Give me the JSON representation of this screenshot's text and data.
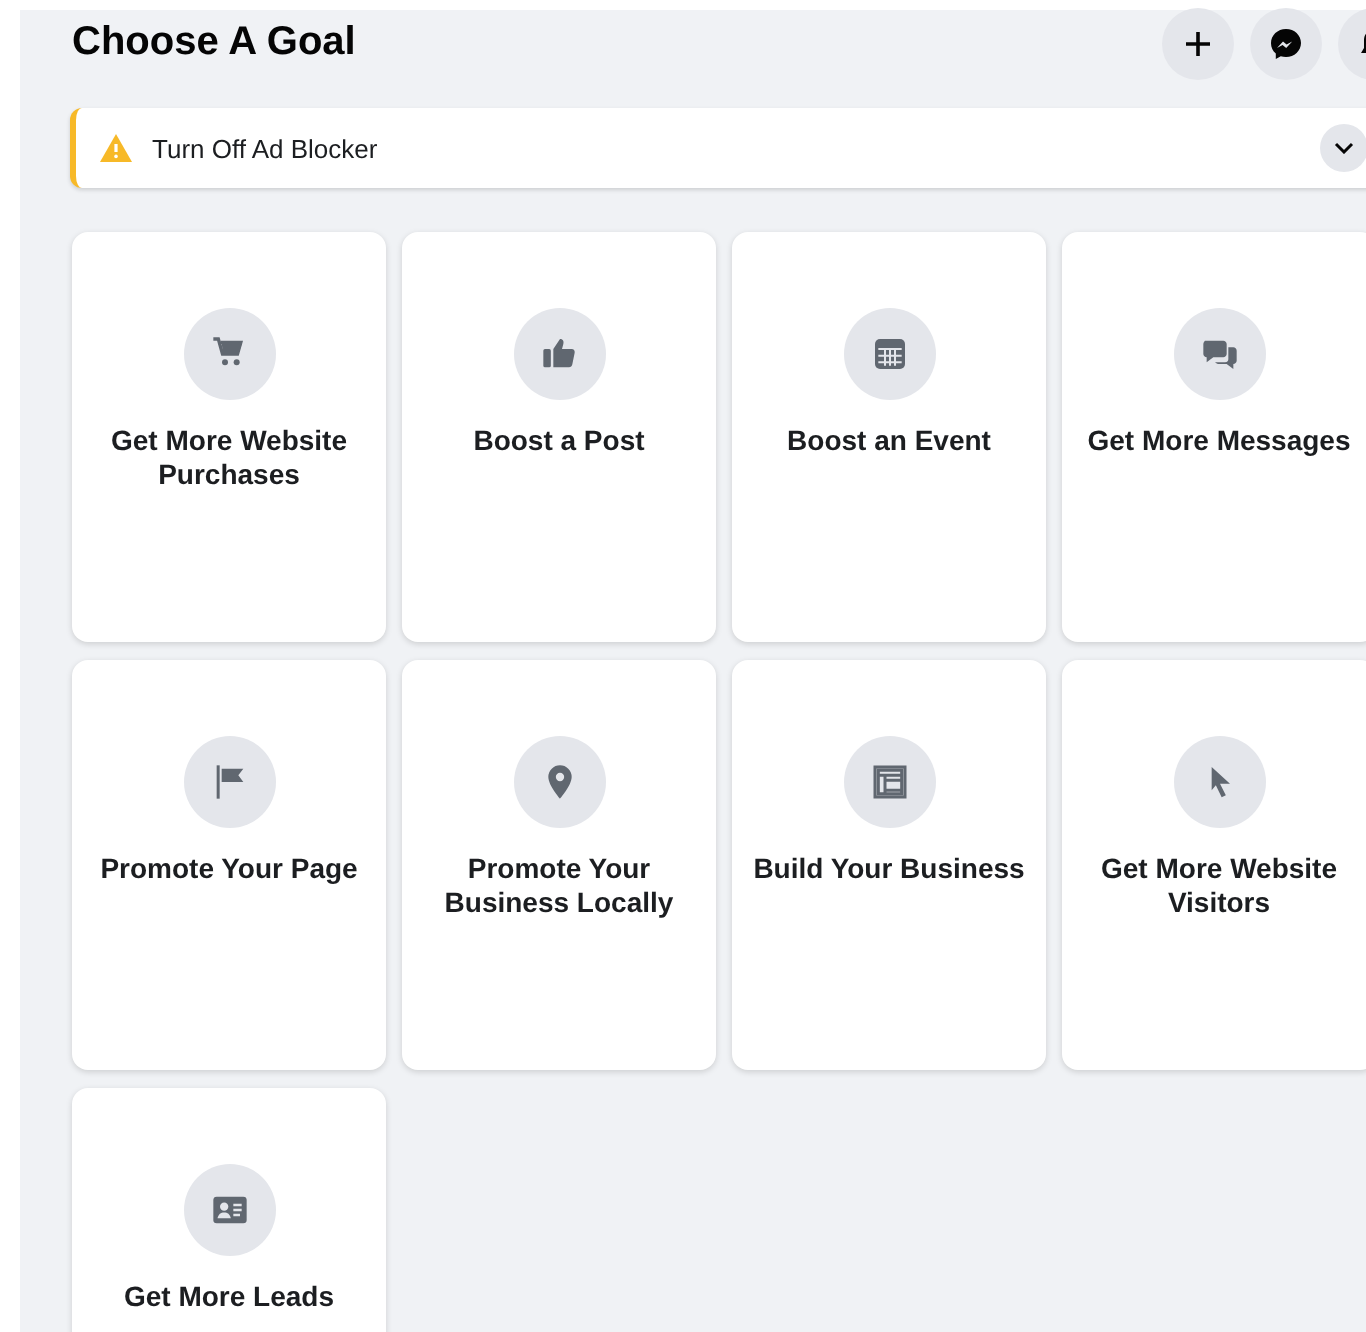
{
  "header": {
    "title": "Choose A Goal"
  },
  "banner": {
    "text": "Turn Off Ad Blocker"
  },
  "goals": [
    {
      "label": "Get More Website Purchases"
    },
    {
      "label": "Boost a Post"
    },
    {
      "label": "Boost an Event"
    },
    {
      "label": "Get More Messages"
    },
    {
      "label": "Promote Your Page"
    },
    {
      "label": "Promote Your Business Locally"
    },
    {
      "label": "Build Your Business"
    },
    {
      "label": "Get More Website Visitors"
    },
    {
      "label": "Get More Leads"
    }
  ]
}
